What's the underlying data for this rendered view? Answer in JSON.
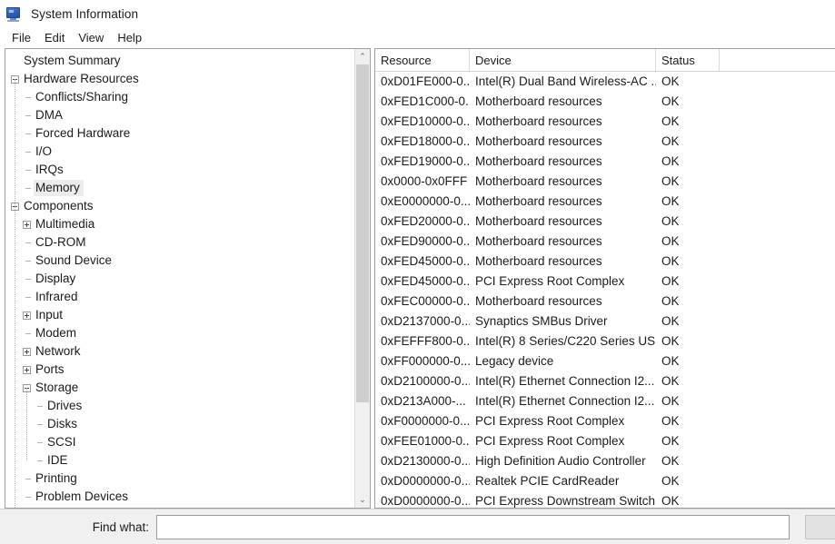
{
  "window": {
    "title": "System Information",
    "icon": "computer-monitor-icon"
  },
  "menu": {
    "items": [
      {
        "label": "File"
      },
      {
        "label": "Edit"
      },
      {
        "label": "View"
      },
      {
        "label": "Help"
      }
    ]
  },
  "tree": {
    "selected": "Memory",
    "nodes": [
      {
        "label": "System Summary",
        "depth": 0,
        "state": "none"
      },
      {
        "label": "Hardware Resources",
        "depth": 0,
        "state": "expanded"
      },
      {
        "label": "Conflicts/Sharing",
        "depth": 1,
        "state": "leaf"
      },
      {
        "label": "DMA",
        "depth": 1,
        "state": "leaf"
      },
      {
        "label": "Forced Hardware",
        "depth": 1,
        "state": "leaf"
      },
      {
        "label": "I/O",
        "depth": 1,
        "state": "leaf"
      },
      {
        "label": "IRQs",
        "depth": 1,
        "state": "leaf"
      },
      {
        "label": "Memory",
        "depth": 1,
        "state": "leaf"
      },
      {
        "label": "Components",
        "depth": 0,
        "state": "expanded"
      },
      {
        "label": "Multimedia",
        "depth": 1,
        "state": "collapsed"
      },
      {
        "label": "CD-ROM",
        "depth": 1,
        "state": "leaf"
      },
      {
        "label": "Sound Device",
        "depth": 1,
        "state": "leaf"
      },
      {
        "label": "Display",
        "depth": 1,
        "state": "leaf"
      },
      {
        "label": "Infrared",
        "depth": 1,
        "state": "leaf"
      },
      {
        "label": "Input",
        "depth": 1,
        "state": "collapsed"
      },
      {
        "label": "Modem",
        "depth": 1,
        "state": "leaf"
      },
      {
        "label": "Network",
        "depth": 1,
        "state": "collapsed"
      },
      {
        "label": "Ports",
        "depth": 1,
        "state": "collapsed"
      },
      {
        "label": "Storage",
        "depth": 1,
        "state": "expanded"
      },
      {
        "label": "Drives",
        "depth": 2,
        "state": "leaf"
      },
      {
        "label": "Disks",
        "depth": 2,
        "state": "leaf"
      },
      {
        "label": "SCSI",
        "depth": 2,
        "state": "leaf"
      },
      {
        "label": "IDE",
        "depth": 2,
        "state": "leaf"
      },
      {
        "label": "Printing",
        "depth": 1,
        "state": "leaf"
      },
      {
        "label": "Problem Devices",
        "depth": 1,
        "state": "leaf"
      }
    ]
  },
  "list": {
    "columns": [
      {
        "label": "Resource"
      },
      {
        "label": "Device"
      },
      {
        "label": "Status"
      }
    ],
    "rows": [
      {
        "resource": "0xD01FE000-0...",
        "device": "Intel(R) Dual Band Wireless-AC ...",
        "status": "OK"
      },
      {
        "resource": "0xFED1C000-0...",
        "device": "Motherboard resources",
        "status": "OK"
      },
      {
        "resource": "0xFED10000-0...",
        "device": "Motherboard resources",
        "status": "OK"
      },
      {
        "resource": "0xFED18000-0...",
        "device": "Motherboard resources",
        "status": "OK"
      },
      {
        "resource": "0xFED19000-0...",
        "device": "Motherboard resources",
        "status": "OK"
      },
      {
        "resource": "0x0000-0x0FFF",
        "device": "Motherboard resources",
        "status": "OK"
      },
      {
        "resource": "0xE0000000-0...",
        "device": "Motherboard resources",
        "status": "OK"
      },
      {
        "resource": "0xFED20000-0...",
        "device": "Motherboard resources",
        "status": "OK"
      },
      {
        "resource": "0xFED90000-0...",
        "device": "Motherboard resources",
        "status": "OK"
      },
      {
        "resource": "0xFED45000-0...",
        "device": "Motherboard resources",
        "status": "OK"
      },
      {
        "resource": "0xFED45000-0...",
        "device": "PCI Express Root Complex",
        "status": "OK"
      },
      {
        "resource": "0xFEC00000-0...",
        "device": "Motherboard resources",
        "status": "OK"
      },
      {
        "resource": "0xD2137000-0...",
        "device": "Synaptics SMBus Driver",
        "status": "OK"
      },
      {
        "resource": "0xFEFFF800-0...",
        "device": "Intel(R) 8 Series/C220 Series US...",
        "status": "OK"
      },
      {
        "resource": "0xFF000000-0...",
        "device": "Legacy device",
        "status": "OK"
      },
      {
        "resource": "0xD2100000-0...",
        "device": "Intel(R) Ethernet Connection I2...",
        "status": "OK"
      },
      {
        "resource": "0xD213A000-...",
        "device": "Intel(R) Ethernet Connection I2...",
        "status": "OK"
      },
      {
        "resource": "0xF0000000-0...",
        "device": "PCI Express Root Complex",
        "status": "OK"
      },
      {
        "resource": "0xFEE01000-0...",
        "device": "PCI Express Root Complex",
        "status": "OK"
      },
      {
        "resource": "0xD2130000-0...",
        "device": "High Definition Audio Controller",
        "status": "OK"
      },
      {
        "resource": "0xD0000000-0...",
        "device": "Realtek PCIE CardReader",
        "status": "OK"
      },
      {
        "resource": "0xD0000000-0...",
        "device": "PCI Express Downstream Switch...",
        "status": "OK"
      }
    ]
  },
  "find": {
    "label": "Find what:",
    "value": "",
    "placeholder": ""
  },
  "scrollbar": {
    "up_arrow": "⌃",
    "down_arrow": "⌄"
  },
  "colors": {
    "window_bg": "#ffffff",
    "chrome_bg": "#f0f0f0",
    "border": "#a0a0a0",
    "selection": "#ececec",
    "text": "#1b1b1b",
    "icon_blue": "#2f5fae"
  }
}
